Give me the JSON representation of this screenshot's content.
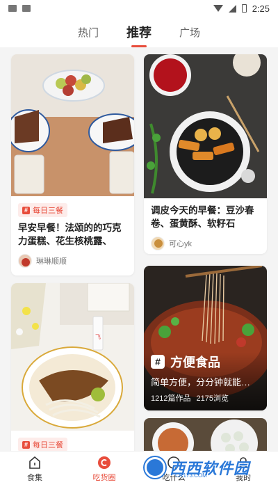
{
  "status_bar": {
    "time": "2:25"
  },
  "tabs": [
    {
      "label": "热门"
    },
    {
      "label": "推荐"
    },
    {
      "label": "广场"
    }
  ],
  "feed": {
    "cards": [
      {
        "badge": "每日三餐",
        "title": "早安早餐！法颂的的巧克力蛋糕、花生核桃露、枣！…",
        "author": "琳琳顺顺"
      },
      {
        "title": "调皮今天的早餐：豆沙春卷、蛋黄酥、软籽石榴、…",
        "author": "可心yk"
      },
      {
        "badge": "每日三餐"
      }
    ],
    "topic_card": {
      "title": "方便食品",
      "subtitle": "简单方便，分分钟就能…",
      "works": "1212篇作品",
      "views": "2175浏览"
    }
  },
  "bottom_nav": [
    {
      "label": "食集"
    },
    {
      "label": "吃货圈"
    },
    {
      "label": "吃什么"
    },
    {
      "label": "我的"
    }
  ],
  "watermark": {
    "text": "西西软件园",
    "sub": "CR173.COM"
  },
  "colors": {
    "accent": "#e84d3c",
    "watermark": "#2a78d8"
  }
}
